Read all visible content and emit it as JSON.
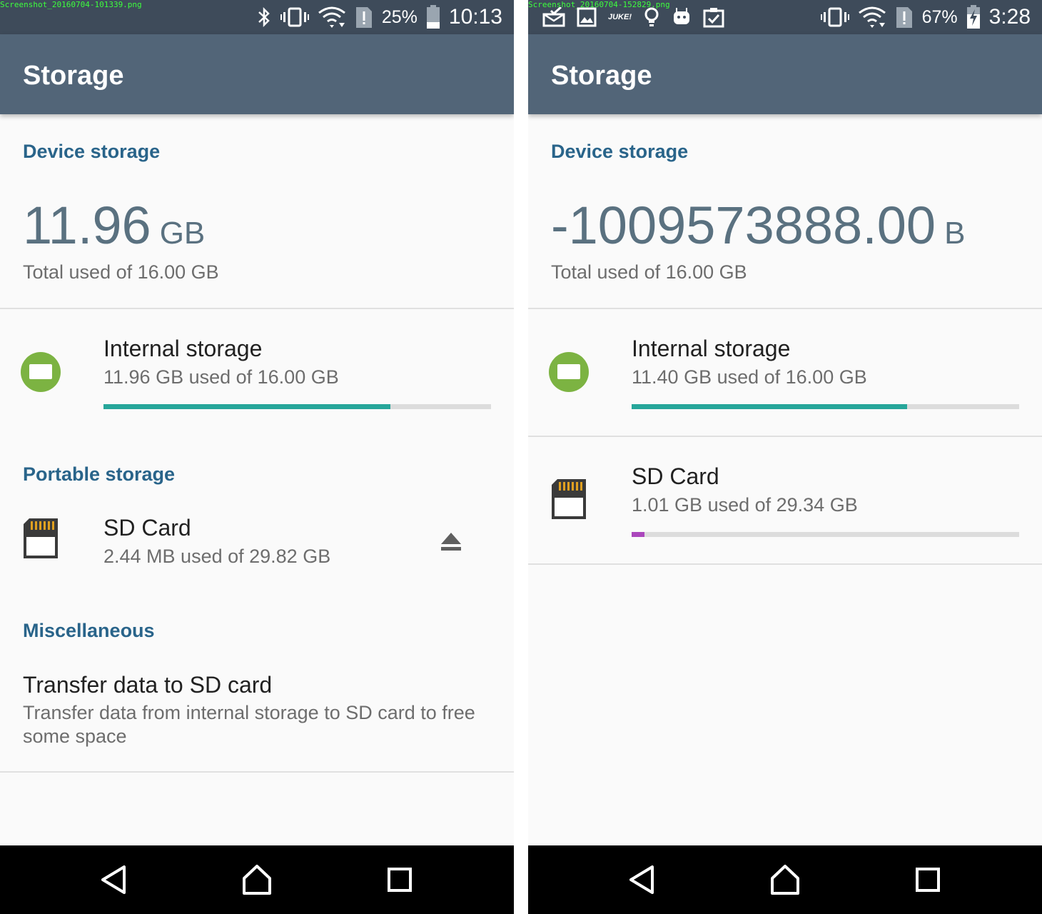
{
  "colors": {
    "status_bar": "#3e4b5a",
    "app_bar": "#526578",
    "section_header": "#29648a",
    "big_number": "#5a7180",
    "internal_bar_fill": "#26a69a",
    "sd_bar_fill": "#ab47bc",
    "bar_track": "#dcdcdc",
    "chip_icon_bg": "#7cb342"
  },
  "left": {
    "screenshot_filename": "Screenshot_20160704-101339.png",
    "status": {
      "icons": [
        "bluetooth-icon",
        "vibrate-icon",
        "wifi-icon",
        "sim-alert-icon",
        "battery-icon"
      ],
      "battery_percent": "25%",
      "time": "10:13"
    },
    "app_title": "Storage",
    "device_storage_header": "Device storage",
    "total_value": "11.96",
    "total_unit": "GB",
    "total_caption": "Total used of 16.00 GB",
    "internal": {
      "icon": "chip-icon",
      "title": "Internal storage",
      "summary": "11.96 GB used of 16.00 GB",
      "used_fraction": 0.74
    },
    "portable_header": "Portable storage",
    "sd": {
      "icon": "sd-card-icon",
      "title": "SD Card",
      "summary": "2.44 MB used of 29.82 GB",
      "eject_icon": "eject-icon"
    },
    "misc_header": "Miscellaneous",
    "transfer": {
      "title": "Transfer data to SD card",
      "line1": "Transfer data from internal storage to SD card to free",
      "line2": "some space"
    },
    "nav": [
      "back-icon",
      "home-icon",
      "recents-icon"
    ]
  },
  "right": {
    "screenshot_filename": "Screenshot_20160704-152829.png",
    "status": {
      "notification_icons": [
        "mail-check-icon",
        "gallery-icon",
        "juke-icon",
        "lightbulb-icon",
        "android-robot-icon",
        "clipboard-check-icon"
      ],
      "juke_text": "JUKE!",
      "icons": [
        "vibrate-icon",
        "wifi-icon",
        "sim-alert-icon",
        "battery-charging-icon"
      ],
      "battery_percent": "67%",
      "time": "3:28"
    },
    "app_title": "Storage",
    "device_storage_header": "Device storage",
    "total_value": "-1009573888.00",
    "total_unit": "B",
    "total_caption": "Total used of 16.00 GB",
    "internal": {
      "icon": "chip-icon",
      "title": "Internal storage",
      "summary": "11.40 GB used of 16.00 GB",
      "used_fraction": 0.71
    },
    "sd": {
      "icon": "sd-card-icon",
      "title": "SD Card",
      "summary": "1.01 GB used of 29.34 GB",
      "used_fraction": 0.034
    },
    "nav": [
      "back-icon",
      "home-icon",
      "recents-icon"
    ]
  }
}
